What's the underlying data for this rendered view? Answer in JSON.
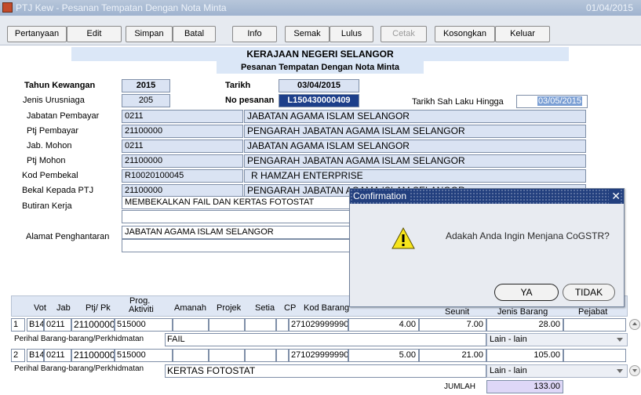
{
  "window": {
    "title": "PTJ Kew - Pesanan Tempatan Dengan Nota Minta",
    "date": "01/04/2015"
  },
  "toolbar": {
    "pertanyaan": "Pertanyaan",
    "edit": "Edit",
    "simpan": "Simpan",
    "batal": "Batal",
    "info": "Info",
    "semak": "Semak",
    "lulus": "Lulus",
    "cetak": "Cetak",
    "kosongkan": "Kosongkan",
    "keluar": "Keluar"
  },
  "header": {
    "title": "KERAJAAN NEGERI SELANGOR",
    "subtitle": "Pesanan Tempatan Dengan Nota Minta"
  },
  "form": {
    "tahun_kewangan_label": "Tahun Kewangan",
    "tahun_kewangan": "2015",
    "tarikh_label": "Tarikh",
    "tarikh": "03/04/2015",
    "jenis_urusniaga_label": "Jenis Urusniaga",
    "jenis_urusniaga": "205",
    "no_pesanan_label": "No pesanan",
    "no_pesanan": "L150430000409",
    "tarikh_sah_label": "Tarikh Sah Laku Hingga",
    "tarikh_sah": "03/05/2015",
    "jabatan_pembayar_label": "Jabatan Pembayar",
    "jabatan_pembayar_code": "0211",
    "jabatan_pembayar_name": "JABATAN AGAMA ISLAM SELANGOR",
    "ptj_pembayar_label": "Ptj Pembayar",
    "ptj_pembayar_code": "21100000",
    "ptj_pembayar_name": "PENGARAH JABATAN AGAMA ISLAM SELANGOR",
    "jab_mohon_label": "Jab. Mohon",
    "jab_mohon_code": "0211",
    "jab_mohon_name": "JABATAN AGAMA ISLAM SELANGOR",
    "ptj_mohon_label": "Ptj Mohon",
    "ptj_mohon_code": "21100000",
    "ptj_mohon_name": "PENGARAH JABATAN AGAMA ISLAM SELANGOR",
    "kod_pembekal_label": "Kod Pembekal",
    "kod_pembekal_code": "R10020100045",
    "kod_pembekal_name": "R HAMZAH ENTERPRISE",
    "bekal_kepada_label": "Bekal Kepada PTJ",
    "bekal_kepada_code": "21100000",
    "bekal_kepada_name": "PENGARAH JABATAN AGAMA ISLAM SELANGOR",
    "butiran_kerja_label": "Butiran Kerja",
    "butiran_kerja_1": "MEMBEKALKAN FAIL DAN KERTAS FOTOSTAT",
    "butiran_kerja_2": "",
    "alamat_label": "Alamat Penghantaran",
    "alamat_1": "JABATAN AGAMA ISLAM SELANGOR",
    "alamat_2": ""
  },
  "grid": {
    "headers": {
      "vot": "Vot",
      "jab": "Jab",
      "ptj_pk": "Ptj/ Pk",
      "prog": "Prog.",
      "aktiviti": "Aktiviti",
      "amanah": "Amanah",
      "projek": "Projek",
      "setia": "Setia",
      "cp": "CP",
      "kod_barang": "Kod Barang",
      "seunit": "Seunit",
      "jenis_barang": "Jenis Barang",
      "pejabat": "Pejabat"
    },
    "perihal_label": "Perihal Barang-barang/Perkhidmatan",
    "rows": [
      {
        "no": "1",
        "vot": "B14",
        "jab": "0211",
        "ptj": "21100000",
        "prog": "515000",
        "kod": "271029999990",
        "qty": "4.00",
        "seunit": "7.00",
        "jumlah": "28.00",
        "perihal": "FAIL",
        "jenis": "Lain - lain"
      },
      {
        "no": "2",
        "vot": "B14",
        "jab": "0211",
        "ptj": "21100000",
        "prog": "515000",
        "kod": "271029999990",
        "qty": "5.00",
        "seunit": "21.00",
        "jumlah": "105.00",
        "perihal": "KERTAS FOTOSTAT",
        "jenis": "Lain - lain"
      }
    ],
    "jumlah_label": "JUMLAH",
    "jumlah": "133.00"
  },
  "dialog": {
    "title": "Confirmation",
    "message": "Adakah Anda Ingin Menjana CoGSTR?",
    "ya": "YA",
    "tidak": "TIDAK"
  },
  "colors": {
    "field_bg": "#dae3f3",
    "title_bar": "#223f7e",
    "selected_field": "#1d3f8a",
    "total_bg": "#ded7f7"
  }
}
